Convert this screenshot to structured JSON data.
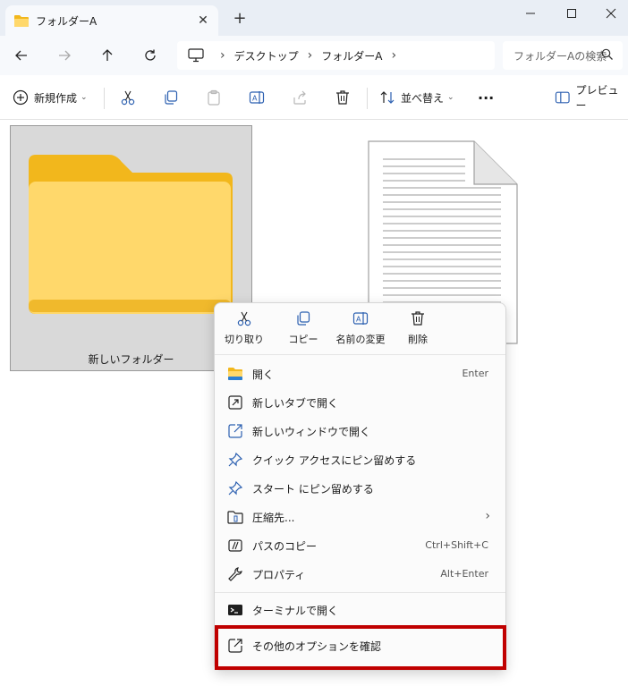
{
  "window": {
    "tab_title": "フォルダーA",
    "new_tab": "+",
    "close_tab": "✕"
  },
  "nav": {
    "breadcrumb": [
      "デスクトップ",
      "フォルダーA"
    ],
    "search_placeholder": "フォルダーAの検索"
  },
  "toolbar": {
    "new_label": "新規作成",
    "sort_label": "並べ替え",
    "more_label": "···",
    "preview_label": "プレビュー"
  },
  "content": {
    "folder_name": "新しいフォルダー"
  },
  "context_menu": {
    "quick_actions": [
      {
        "label": "切り取り",
        "icon": "scissors-icon"
      },
      {
        "label": "コピー",
        "icon": "copy-icon"
      },
      {
        "label": "名前の変更",
        "icon": "rename-icon"
      },
      {
        "label": "削除",
        "icon": "trash-icon"
      }
    ],
    "items": [
      {
        "label": "開く",
        "shortcut": "Enter",
        "icon": "folder-icon"
      },
      {
        "label": "新しいタブで開く",
        "shortcut": "",
        "icon": "new-tab-icon"
      },
      {
        "label": "新しいウィンドウで開く",
        "shortcut": "",
        "icon": "new-window-icon"
      },
      {
        "label": "クイック アクセスにピン留めする",
        "shortcut": "",
        "icon": "pin-icon"
      },
      {
        "label": "スタート にピン留めする",
        "shortcut": "",
        "icon": "pin-icon"
      },
      {
        "label": "圧縮先...",
        "shortcut": "",
        "icon": "zip-icon"
      },
      {
        "label": "パスのコピー",
        "shortcut": "Ctrl+Shift+C",
        "icon": "path-icon"
      },
      {
        "label": "プロパティ",
        "shortcut": "Alt+Enter",
        "icon": "wrench-icon"
      },
      {
        "label": "ターミナルで開く",
        "shortcut": "",
        "icon": "terminal-icon"
      },
      {
        "label": "その他のオプションを確認",
        "shortcut": "",
        "icon": "more-options-icon"
      }
    ]
  },
  "colors": {
    "accent": "#0067c0",
    "folder_light": "#ffd86b",
    "folder_dark": "#f2b71c",
    "highlight": "#c00000"
  }
}
